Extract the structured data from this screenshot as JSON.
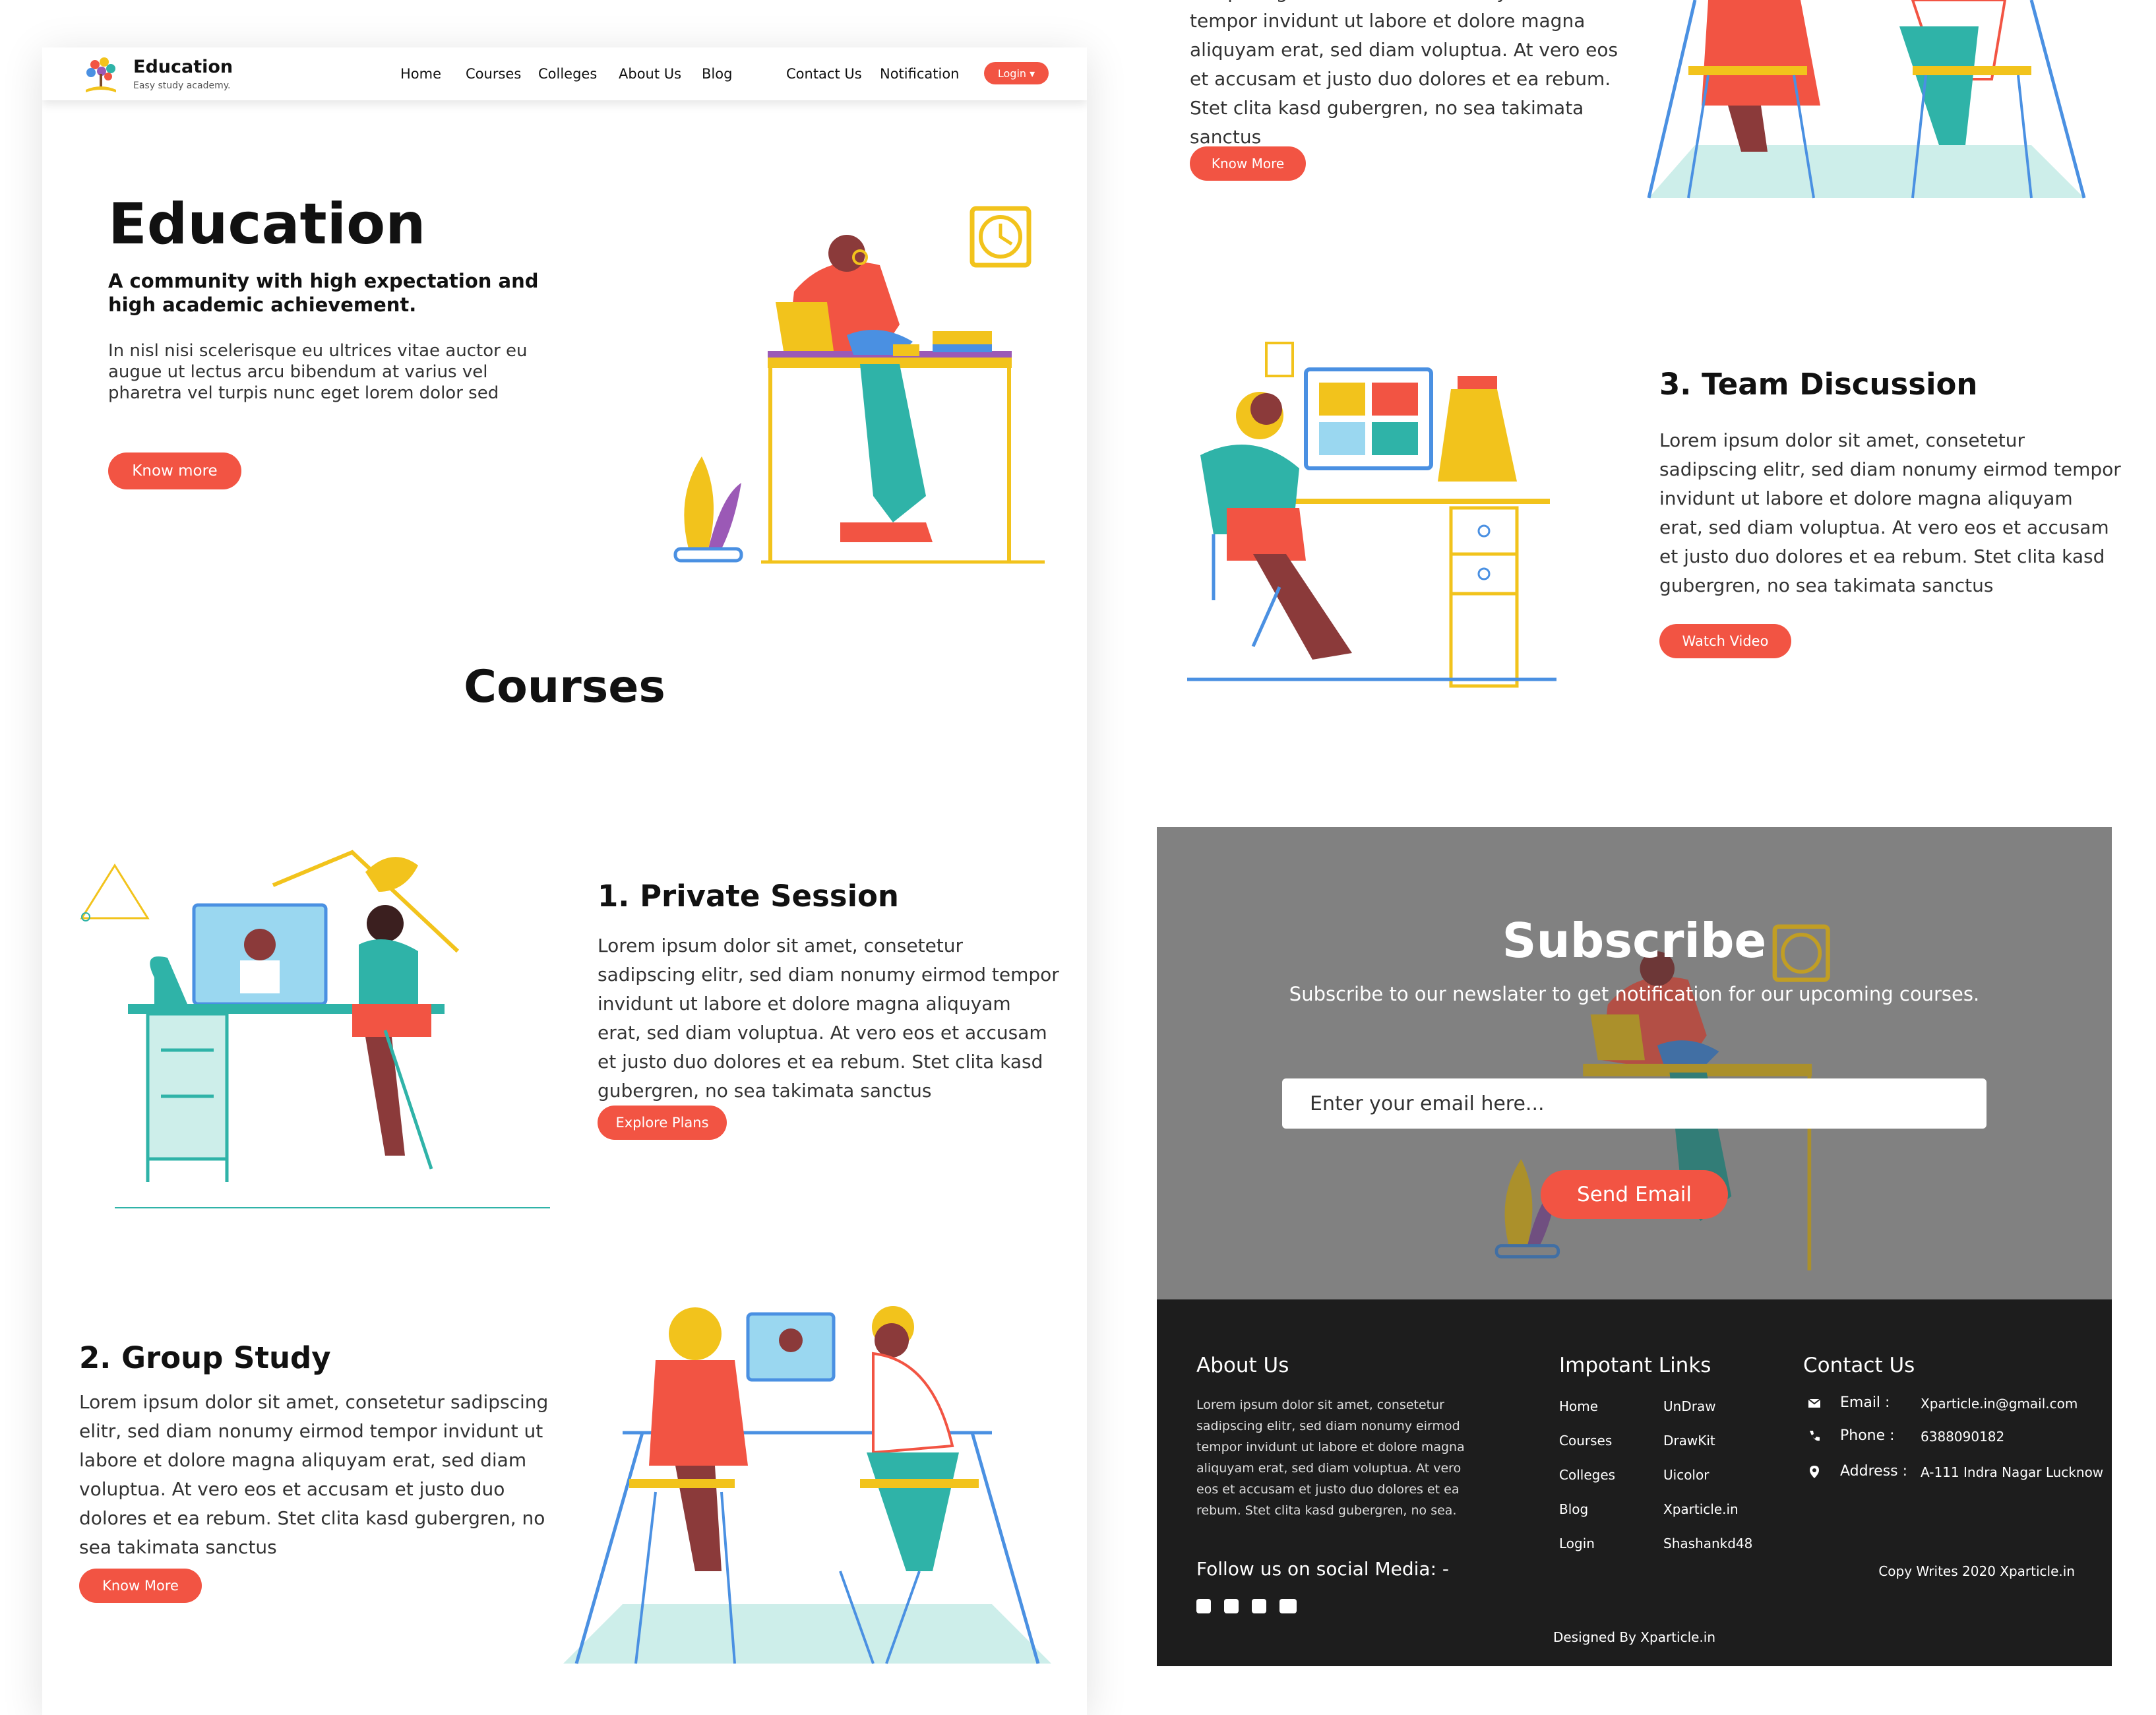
{
  "colors": {
    "accent": "#f25443",
    "subscribe_bg": "#818181",
    "footer_bg": "#1d1d1d"
  },
  "nav": {
    "brand": "Education",
    "tagline": "Easy study academy.",
    "links": [
      "Home",
      "Courses",
      "Colleges",
      "About Us",
      "Blog",
      "Contact Us",
      "Notification"
    ],
    "login": "Login ▾"
  },
  "hero": {
    "title": "Education",
    "subtitle": "A community with high expectation and high academic achievement.",
    "body": "In nisl nisi scelerisque eu ultrices vitae auctor eu augue ut lectus arcu bibendum at varius vel pharetra vel turpis nunc eget lorem dolor sed",
    "button": "Know more"
  },
  "courses": {
    "title": "Courses",
    "items": [
      {
        "title": "1. Private Session",
        "body": "Lorem ipsum dolor sit amet, consetetur sadipscing elitr, sed diam nonumy eirmod tempor invidunt ut labore et dolore magna aliquyam erat, sed diam voluptua. At vero eos et accusam et justo duo dolores et ea rebum. Stet clita kasd gubergren, no sea takimata sanctus",
        "button": "Explore Plans"
      },
      {
        "title": "2. Group Study",
        "body": "Lorem ipsum dolor sit amet, consetetur sadipscing elitr, sed diam nonumy eirmod tempor invidunt ut labore et dolore magna aliquyam erat, sed diam voluptua. At vero eos et accusam et justo duo dolores et ea rebum. Stet clita kasd gubergren, no sea takimata sanctus",
        "button": "Know More"
      },
      {
        "title": "3. Team Discussion",
        "body": "Lorem ipsum dolor sit amet, consetetur sadipscing elitr, sed diam nonumy eirmod tempor invidunt ut labore et dolore magna aliquyam erat, sed diam voluptua. At vero eos et accusam et justo duo dolores et ea rebum. Stet clita kasd gubergren, no sea takimata sanctus",
        "button": "Watch Video"
      }
    ]
  },
  "right_top": {
    "body": "sadipscing elitr, sed diam nonumy eirmod tempor invidunt ut labore et dolore magna aliquyam erat, sed diam voluptua. At vero eos et accusam et justo duo dolores et ea rebum. Stet clita kasd gubergren, no sea takimata sanctus",
    "button": "Know More"
  },
  "subscribe": {
    "title": "Subscribe",
    "text": "Subscribe to our newslater to get notification for our upcoming courses.",
    "placeholder": "Enter your email here...",
    "button": "Send Email"
  },
  "footer": {
    "about_title": "About Us",
    "about_text": "Lorem ipsum dolor sit amet, consetetur sadipscing elitr, sed diam nonumy eirmod tempor invidunt ut labore et dolore magna aliquyam erat, sed diam voluptua. At vero eos et accusam et justo duo dolores et ea rebum. Stet clita kasd gubergren, no sea.",
    "follow": "Follow us on social Media: -",
    "social_icons": [
      "instagram-icon",
      "facebook-icon",
      "twitter-icon",
      "youtube-icon"
    ],
    "links_title": "Impotant Links",
    "links_col1": [
      "Home",
      "Courses",
      "Colleges",
      "Blog",
      "Login"
    ],
    "links_col2": [
      "UnDraw",
      "DrawKit",
      "Uicolor",
      "Xparticle.in",
      "Shashankd48"
    ],
    "contact_title": "Contact Us",
    "email_label": "Email :",
    "email": "Xparticle.in@gmail.com",
    "phone_label": "Phone :",
    "phone": "6388090182",
    "address_label": "Address :",
    "address": "A-111 Indra Nagar Lucknow",
    "copyright": "Copy Writes 2020 Xparticle.in",
    "designed_by": "Designed By Xparticle.in"
  }
}
